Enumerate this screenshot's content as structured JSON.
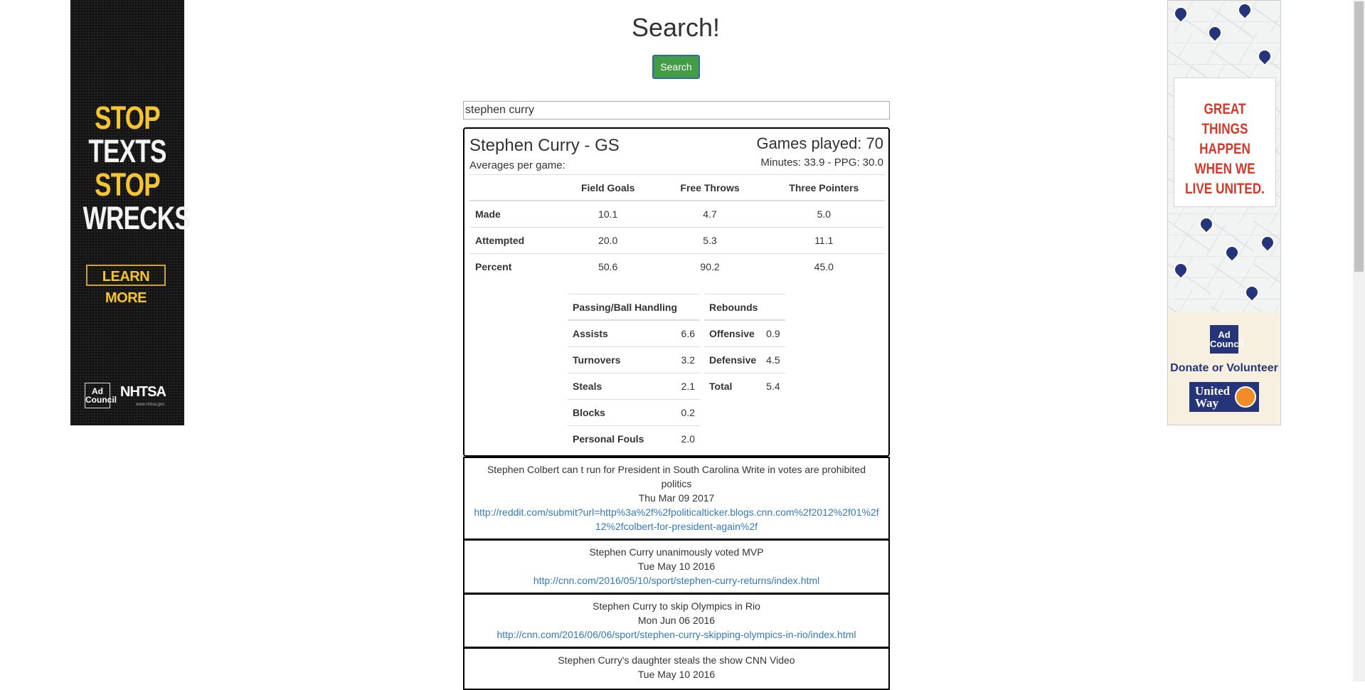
{
  "page": {
    "title": "Search!"
  },
  "search": {
    "button_label": "Search",
    "query": "stephen curry"
  },
  "player": {
    "name": "Stephen Curry - GS",
    "averages_label": "Averages per game:",
    "games_played": "Games played: 70",
    "minutes_ppg": "Minutes: 33.9 - PPG: 30.0"
  },
  "shooting": {
    "columns": [
      "Field Goals",
      "Free Throws",
      "Three Pointers"
    ],
    "rows": [
      {
        "label": "Made",
        "values": [
          "10.1",
          "4.7",
          "5.0"
        ]
      },
      {
        "label": "Attempted",
        "values": [
          "20.0",
          "5.3",
          "11.1"
        ]
      },
      {
        "label": "Percent",
        "values": [
          "50.6",
          "90.2",
          "45.0"
        ]
      }
    ]
  },
  "passing": {
    "header": "Passing/Ball Handling",
    "rows": [
      {
        "label": "Assists",
        "value": "6.6"
      },
      {
        "label": "Turnovers",
        "value": "3.2"
      },
      {
        "label": "Steals",
        "value": "2.1"
      },
      {
        "label": "Blocks",
        "value": "0.2"
      },
      {
        "label": "Personal Fouls",
        "value": "2.0"
      }
    ]
  },
  "rebounds": {
    "header": "Rebounds",
    "rows": [
      {
        "label": "Offensive",
        "value": "0.9"
      },
      {
        "label": "Defensive",
        "value": "4.5"
      },
      {
        "label": "Total",
        "value": "5.4"
      }
    ]
  },
  "news": [
    {
      "headline": "Stephen Colbert can t run for President in South Carolina Write in votes are prohibited politics",
      "date": "Thu Mar 09 2017",
      "url": "http://reddit.com/submit?url=http%3a%2f%2fpoliticalticker.blogs.cnn.com%2f2012%2f01%2f12%2fcolbert-for-president-again%2f"
    },
    {
      "headline": "Stephen Curry unanimously voted MVP",
      "date": "Tue May 10 2016",
      "url": "http://cnn.com/2016/05/10/sport/stephen-curry-returns/index.html"
    },
    {
      "headline": "Stephen Curry to skip Olympics in Rio",
      "date": "Mon Jun 06 2016",
      "url": "http://cnn.com/2016/06/06/sport/stephen-curry-skipping-olympics-in-rio/index.html"
    },
    {
      "headline": "Stephen Curry's daughter steals the show CNN Video",
      "date": "Tue May 10 2016",
      "url": ""
    }
  ],
  "ads": {
    "left": {
      "lines": [
        "STOP",
        "TEXTS",
        "STOP",
        "WRECKS"
      ],
      "cta": "LEARN MORE",
      "logo1": "Ad Council",
      "logo2": "NHTSA",
      "logo2_url": "www.nhtsa.gov"
    },
    "right": {
      "lines": [
        "GREAT THINGS",
        "HAPPEN",
        "WHEN WE",
        "LIVE UNITED."
      ],
      "logo1": "Ad Council",
      "cta": "Donate or Volunteer",
      "logo2": "United Way"
    }
  }
}
